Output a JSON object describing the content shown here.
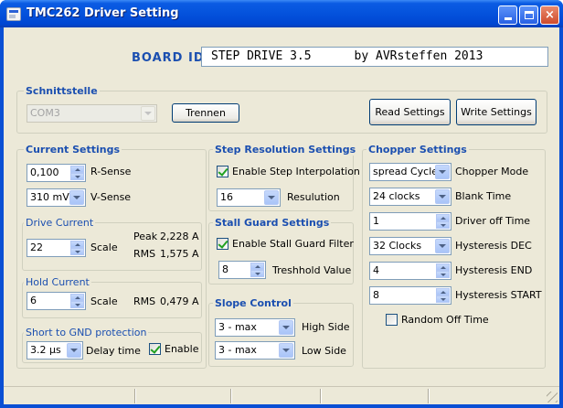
{
  "window": {
    "title": "TMC262 Driver Setting",
    "controls": {
      "minimize": "minimize",
      "maximize": "maximize",
      "close": "×"
    }
  },
  "board": {
    "label": "BOARD ID:",
    "value": "STEP DRIVE 3.5      by AVRsteffen 2013"
  },
  "schnittstelle": {
    "title": "Schnittstelle",
    "port": "COM3",
    "disconnect_label": "Trennen",
    "read_label": "Read Settings",
    "write_label": "Write Settings"
  },
  "current": {
    "title": "Current Settings",
    "rsense_value": "0,100",
    "rsense_label": "R-Sense",
    "vsense_value": "310 mV",
    "vsense_label": "V-Sense",
    "drive": {
      "title": "Drive Current",
      "scale_value": "22",
      "scale_label": "Scale",
      "peak_label": "Peak",
      "peak_value": "2,228 A",
      "rms_label": "RMS",
      "rms_value": "1,575 A"
    },
    "hold": {
      "title": "Hold Current",
      "scale_value": "6",
      "scale_label": "Scale",
      "rms_label": "RMS",
      "rms_value": "0,479 A"
    },
    "short": {
      "title": "Short to GND protection",
      "delay_value": "3.2 µs",
      "delay_label": "Delay time",
      "enable_label": "Enable",
      "enable_checked": true
    }
  },
  "step": {
    "title": "Step Resolution Settings",
    "interp_label": "Enable Step Interpolation",
    "interp_checked": true,
    "resolution_value": "16",
    "resolution_label": "Resulution"
  },
  "stall": {
    "title": "Stall Guard Settings",
    "filter_label": "Enable Stall Guard Filter",
    "filter_checked": true,
    "threshold_value": "8",
    "threshold_label": "Treshhold Value"
  },
  "slope": {
    "title": "Slope Control",
    "high_value": "3 - max",
    "high_label": "High Side",
    "low_value": "3 - max",
    "low_label": "Low Side"
  },
  "chopper": {
    "title": "Chopper Settings",
    "mode_value": "spread Cycle",
    "mode_label": "Chopper Mode",
    "blank_value": "24 clocks",
    "blank_label": "Blank Time",
    "offtime_value": "1",
    "offtime_label": "Driver off Time",
    "hdec_value": "32 Clocks",
    "hdec_label": "Hysteresis DEC",
    "hend_value": "4",
    "hend_label": "Hysteresis END",
    "hstart_value": "8",
    "hstart_label": "Hysteresis START",
    "random_label": "Random Off Time",
    "random_checked": false
  }
}
